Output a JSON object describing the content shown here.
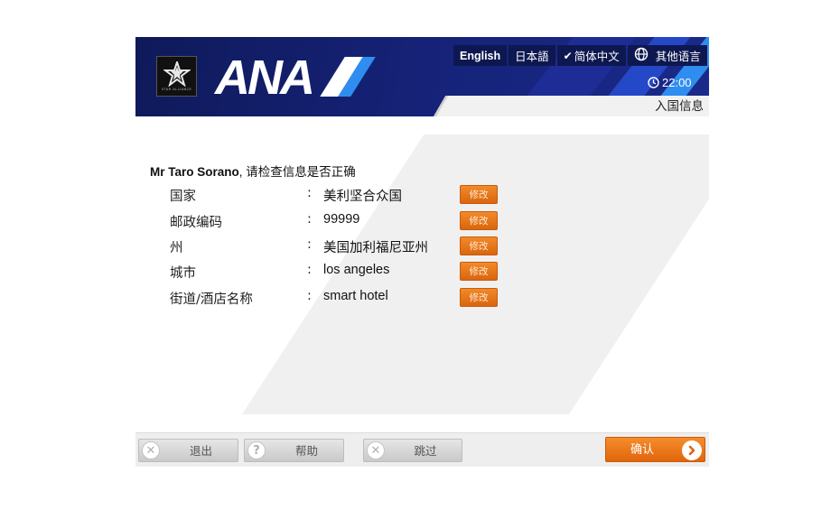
{
  "header": {
    "star_alliance_caption": "STAR ALLIANCE",
    "airline_logo": "ANA",
    "languages": [
      {
        "label": "English",
        "selected": false
      },
      {
        "label": "日本語",
        "selected": false
      },
      {
        "label": "简体中文",
        "selected": true
      },
      {
        "label": "其他语言",
        "selected": false,
        "icon": "globe-icon"
      }
    ],
    "time": "22:00",
    "section_title": "入国信息"
  },
  "main": {
    "passenger_name": "Mr Taro Sorano",
    "instruction": ", 请检查信息是否正确",
    "fields": [
      {
        "label": "国家",
        "value": "美利坚合众国",
        "edit_label": "修改"
      },
      {
        "label": "邮政编码",
        "value": "99999",
        "edit_label": "修改"
      },
      {
        "label": "州",
        "value": "美国加利福尼亚州",
        "edit_label": "修改"
      },
      {
        "label": "城市",
        "value": "los angeles",
        "edit_label": "修改"
      },
      {
        "label": "街道/酒店名称",
        "value": "smart hotel",
        "edit_label": "修改"
      }
    ],
    "separator": ":"
  },
  "footer": {
    "exit_label": "退出",
    "help_label": "帮助",
    "help_icon_glyph": "?",
    "skip_label": "跳过",
    "confirm_label": "确认"
  },
  "colors": {
    "header_navy": "#16237a",
    "accent_blue": "#1e6fe0",
    "edit_orange": "#e4701a",
    "confirm_orange": "#ef7a20"
  }
}
